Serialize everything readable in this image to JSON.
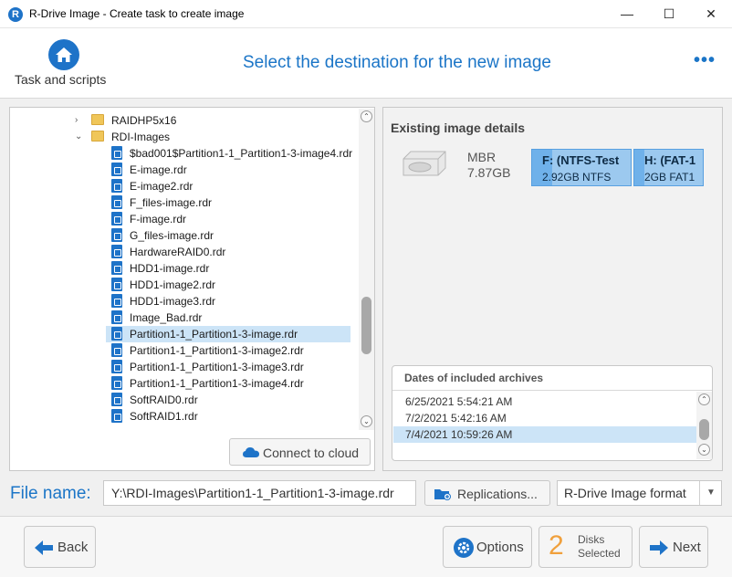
{
  "window": {
    "app_icon_letter": "R",
    "title": "R-Drive Image - Create task to create image",
    "minimize": "—",
    "maximize": "☐",
    "close": "✕"
  },
  "header": {
    "task_label": "Task and scripts",
    "heading": "Select the destination for the new image",
    "more": "•••"
  },
  "tree": {
    "items": [
      {
        "label": "RAIDHP5x16",
        "type": "folder",
        "expanded": false
      },
      {
        "label": "RDI-Images",
        "type": "folder",
        "expanded": true
      },
      {
        "label": "$bad001$Partition1-1_Partition1-3-image4.rdr",
        "type": "file"
      },
      {
        "label": "E-image.rdr",
        "type": "file"
      },
      {
        "label": "E-image2.rdr",
        "type": "file"
      },
      {
        "label": "F_files-image.rdr",
        "type": "file"
      },
      {
        "label": "F-image.rdr",
        "type": "file"
      },
      {
        "label": "G_files-image.rdr",
        "type": "file"
      },
      {
        "label": "HardwareRAID0.rdr",
        "type": "file"
      },
      {
        "label": "HDD1-image.rdr",
        "type": "file"
      },
      {
        "label": "HDD1-image2.rdr",
        "type": "file"
      },
      {
        "label": "HDD1-image3.rdr",
        "type": "file"
      },
      {
        "label": "Image_Bad.rdr",
        "type": "file"
      },
      {
        "label": "Partition1-1_Partition1-3-image.rdr",
        "type": "file",
        "selected": true
      },
      {
        "label": "Partition1-1_Partition1-3-image2.rdr",
        "type": "file"
      },
      {
        "label": "Partition1-1_Partition1-3-image3.rdr",
        "type": "file"
      },
      {
        "label": "Partition1-1_Partition1-3-image4.rdr",
        "type": "file"
      },
      {
        "label": "SoftRAID0.rdr",
        "type": "file"
      },
      {
        "label": "SoftRAID1.rdr",
        "type": "file"
      }
    ],
    "scroll_up": "⌃",
    "scroll_down": "⌄",
    "connect_cloud_label": "Connect to cloud"
  },
  "details": {
    "title": "Existing image details",
    "disk_type": "MBR",
    "disk_size": "7.87GB",
    "partitions": [
      {
        "name": "F: (NTFS-Test",
        "desc": "2.92GB NTFS",
        "used_fraction": 0.2
      },
      {
        "name": "H: (FAT-1",
        "desc": "2GB FAT1",
        "used_fraction": 0.15
      }
    ],
    "dates_header": "Dates of included archives",
    "dates": [
      {
        "label": "6/25/2021 5:54:21 AM",
        "selected": false
      },
      {
        "label": "7/2/2021 5:42:16 AM",
        "selected": false
      },
      {
        "label": "7/4/2021 10:59:26 AM",
        "selected": true
      }
    ]
  },
  "file": {
    "label": "File name:",
    "value": "Y:\\RDI-Images\\Partition1-1_Partition1-3-image.rdr",
    "replications_label": "Replications...",
    "format_value": "R-Drive Image format",
    "format_arrow": "▼"
  },
  "footer": {
    "back_label": "Back",
    "options_label": "Options",
    "disks_count": "2",
    "disks_line1": "Disks",
    "disks_line2": "Selected",
    "next_label": "Next"
  },
  "colors": {
    "accent": "#1b75c7",
    "selection": "#cce4f7",
    "partition": "#9cc9ef",
    "disk_count": "#f0a03c"
  }
}
